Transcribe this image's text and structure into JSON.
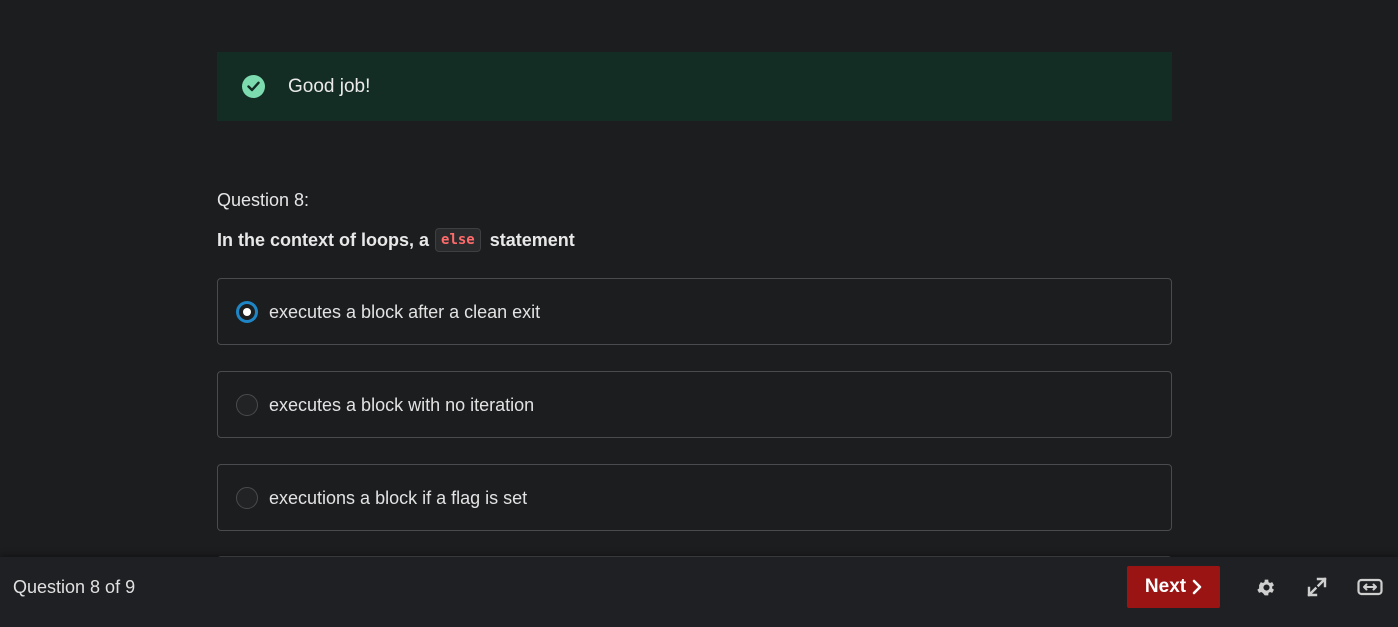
{
  "feedback": {
    "message": "Good job!",
    "icon": "check-circle-icon",
    "color": "#132d24"
  },
  "question": {
    "number_label": "Question 8:",
    "text_before": "In the context of loops, a",
    "code": "else",
    "text_after": "statement"
  },
  "options": [
    {
      "label": "executes a block after a clean exit",
      "selected": true
    },
    {
      "label": "executes a block with no iteration",
      "selected": false
    },
    {
      "label": "executions a block if a flag is set",
      "selected": false
    }
  ],
  "footer": {
    "progress": "Question 8 of 9",
    "next_label": "Next",
    "next_color": "#9b1414",
    "icons": [
      "gear-icon",
      "expand-icon",
      "width-toggle-icon"
    ]
  }
}
